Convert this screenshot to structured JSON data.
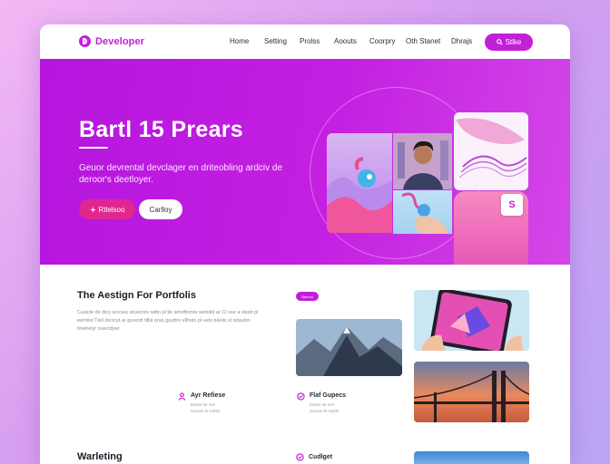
{
  "brand": {
    "name": "Developer",
    "accent": "#c21fd8",
    "pink": "#e0278f"
  },
  "nav": {
    "links": [
      "Home",
      "Setting",
      "Prolss",
      "Aoouts",
      "Coorpry",
      "Oth Stanet",
      "Dhrajs"
    ],
    "cta_label": "Stlke"
  },
  "hero": {
    "title": "Bartl 15 Prears",
    "subtitle": "Geuor devrental devclager en driteobling ardciv de deroor's deetloyer.",
    "primary_button": "Rtlelsoo",
    "secondary_button": "Carlloy",
    "badge": "S",
    "icons": {
      "primary_button_icon": "sparkle-icon",
      "badge_icon": "s-logo-icon"
    }
  },
  "section": {
    "title": "The Aestign For Portfolis",
    "description": "Cusicle de dicy acrcew sicatcrev wittn pl tle amoftnmte wetolld ar Cl nse a slsstt pl eemtiol Tlsli dscicyt ar gurerdt tlllsl oras gsuttre ullhsto pl uets tulelic sl sdaulnn tmelrelyr ouerctlyer.",
    "pill": "Beedcl",
    "features": [
      {
        "title": "Ayr Refiese",
        "desc": "Esttse ulr sen Seoree fe Sottnl",
        "icon": "person-icon"
      },
      {
        "title": "Flaf Gupecs",
        "desc": "Esttse ulr sen Seoree fe Sottnl",
        "icon": "circle-check-icon"
      }
    ],
    "bottom_heading": "Warleting",
    "bottom_feature": {
      "title": "Cudlget",
      "icon": "circle-check-icon"
    }
  }
}
